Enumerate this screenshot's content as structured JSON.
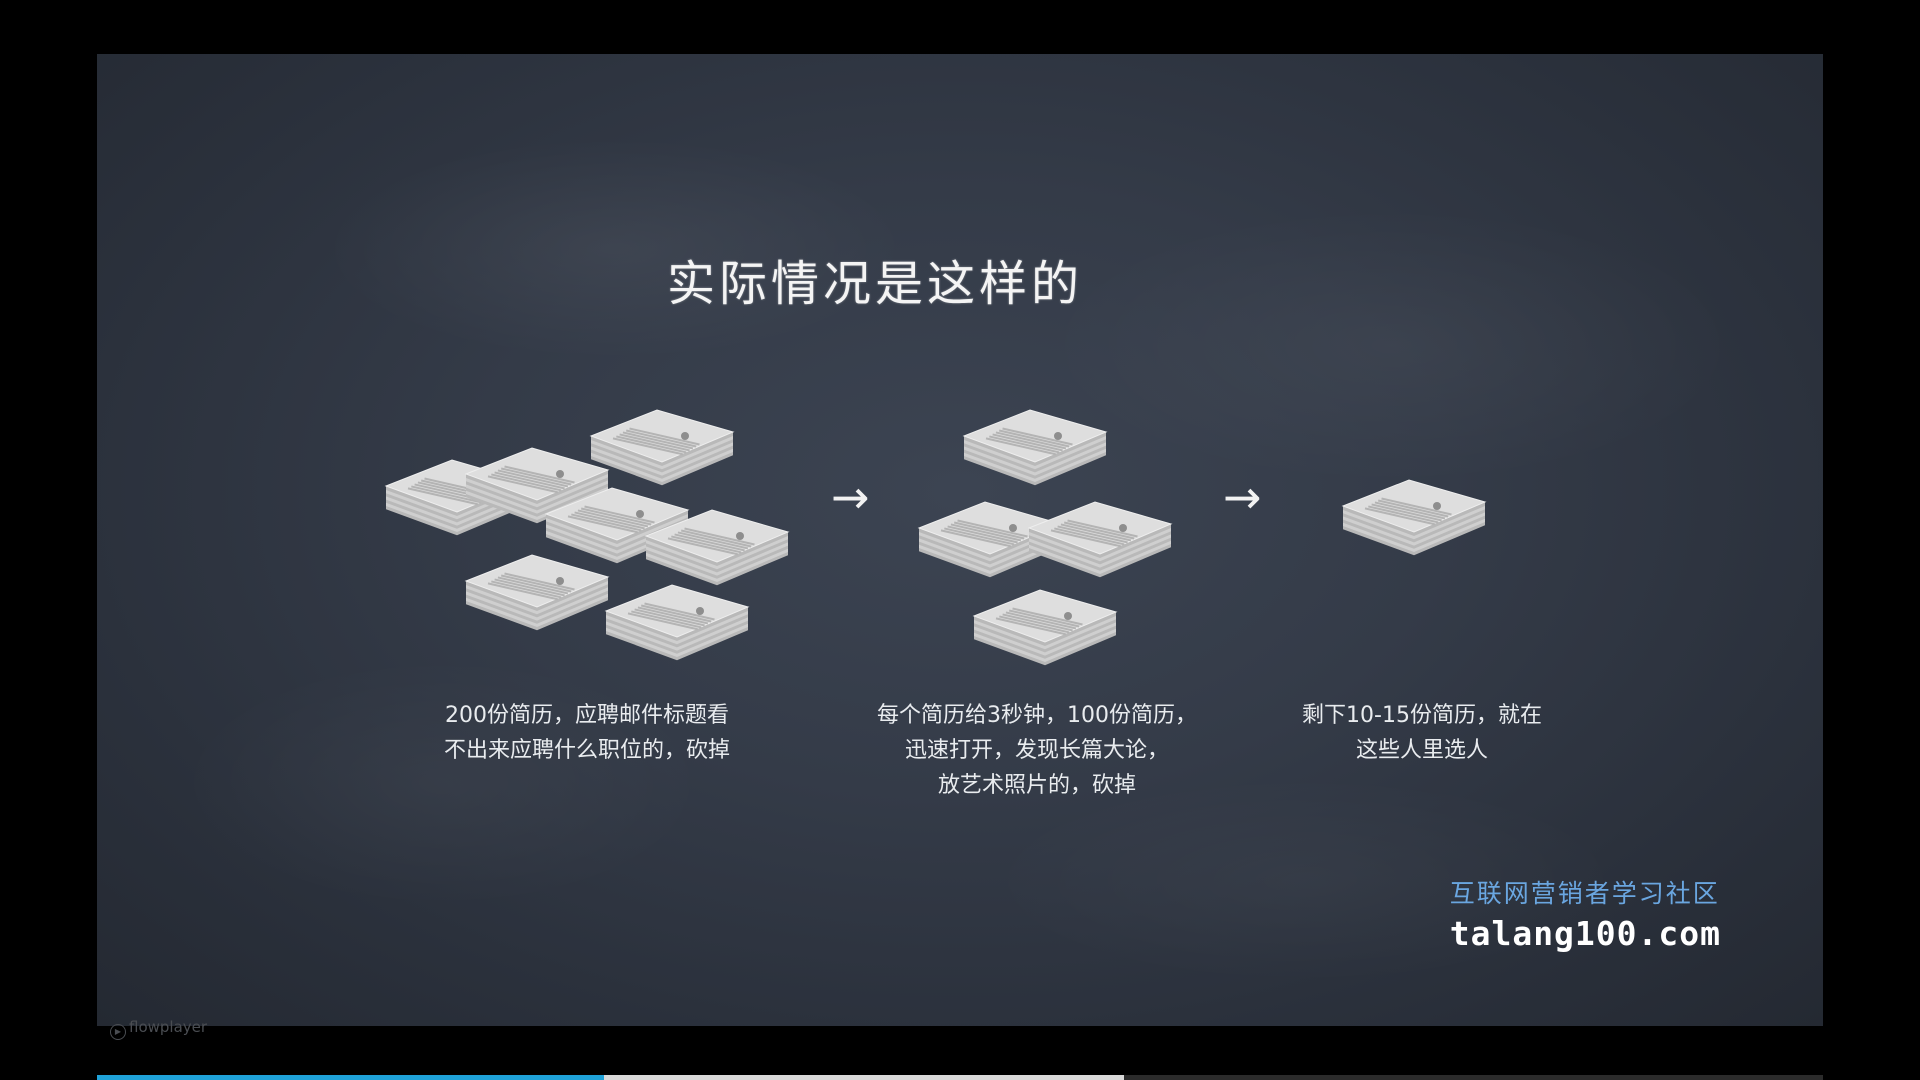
{
  "player": {
    "brand": "flowplayer",
    "progress_played": 0.294,
    "progress_buffered": 0.595,
    "played_color": "#1fa2d8",
    "buffer_color": "#d9d9d9"
  },
  "slide": {
    "title": "实际情况是这样的",
    "arrow_glyph": "→",
    "steps": [
      {
        "stack_count": 7,
        "caption_lines": [
          "200份简历，应聘邮件标题看",
          "不出来应聘什么职位的，砍掉"
        ]
      },
      {
        "stack_count": 4,
        "caption_lines": [
          "每个简历给3秒钟，100份简历，",
          "迅速打开，发现长篇大论，",
          "放艺术照片的，砍掉"
        ]
      },
      {
        "stack_count": 1,
        "caption_lines": [
          "剩下10-15份简历，就在",
          "这些人里选人"
        ]
      }
    ]
  },
  "watermark": {
    "community": "互联网营销者学习社区",
    "url": "talang100.com"
  }
}
